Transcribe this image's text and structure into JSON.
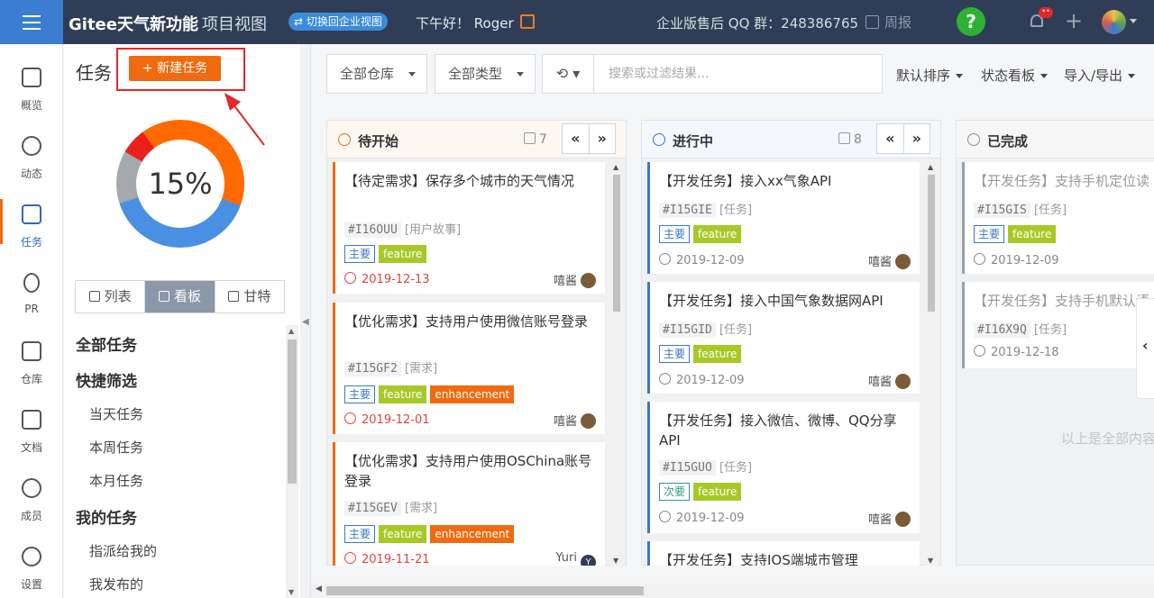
{
  "topbar": {
    "brand": "Gitee天气新功能",
    "brand_sub": "项目视图",
    "switch_label": "⇄ 切换回企业视图",
    "greeting": "下午好！ Roger",
    "qq_group": "企业版售后 QQ 群：248386765",
    "weekly": "周报",
    "help": "?",
    "notify_badge": "••"
  },
  "nav": [
    {
      "label": "概览",
      "icon": "overview-icon"
    },
    {
      "label": "动态",
      "icon": "activity-icon"
    },
    {
      "label": "任务",
      "icon": "task-icon",
      "active": true
    },
    {
      "label": "PR",
      "icon": "pull-request-icon"
    },
    {
      "label": "仓库",
      "icon": "repository-icon"
    },
    {
      "label": "文档",
      "icon": "document-icon"
    },
    {
      "label": "成员",
      "icon": "members-icon"
    },
    {
      "label": "设置",
      "icon": "settings-icon"
    }
  ],
  "panel": {
    "title": "任务",
    "new_task": "+ 新建任务",
    "progress": "15%",
    "view_tabs": [
      "列表",
      "看板",
      "甘特"
    ],
    "filters": {
      "all": "全部任务",
      "quick": "快捷筛选",
      "today": "当天任务",
      "week": "本周任务",
      "month": "本月任务",
      "mine": "我的任务",
      "assigned": "指派给我的",
      "published": "我发布的"
    }
  },
  "toolbar": {
    "repo": "全部仓库",
    "type": "全部类型",
    "search_placeholder": "搜索或过滤结果...",
    "sort": "默认排序",
    "board": "状态看板",
    "import_export": "导入/导出"
  },
  "columns": [
    {
      "title": "待开始",
      "count": "7",
      "color": "#f06a0f",
      "cards": [
        {
          "title": "【待定需求】保存多个城市的天气情况",
          "id": "#I16OUU",
          "kind": "[用户故事]",
          "tags": [
            "主要",
            "feature"
          ],
          "date": "2019-12-13",
          "assignee": "嘻酱"
        },
        {
          "title": "【优化需求】支持用户使用微信账号登录",
          "id": "#I15GF2",
          "kind": "[需求]",
          "tags": [
            "主要",
            "feature",
            "enhancement"
          ],
          "date": "2019-12-01",
          "assignee": "嘻酱"
        },
        {
          "title": "【优化需求】支持用户使用OSChina账号登录",
          "id": "#I15GEV",
          "kind": "[需求]",
          "tags": [
            "主要",
            "feature",
            "enhancement"
          ],
          "date": "2019-11-21",
          "assignee": "Yuri"
        }
      ]
    },
    {
      "title": "进行中",
      "count": "8",
      "color": "#3a78c3",
      "cards": [
        {
          "title": "【开发任务】接入xx气象API",
          "id": "#I15GIE",
          "kind": "[任务]",
          "tags": [
            "主要",
            "feature"
          ],
          "date": "2019-12-09",
          "assignee": "嘻酱"
        },
        {
          "title": "【开发任务】接入中国气象数据网API",
          "id": "#I15GID",
          "kind": "[任务]",
          "tags": [
            "主要",
            "feature"
          ],
          "date": "2019-12-09",
          "assignee": "嘻酱"
        },
        {
          "title": "【开发任务】接入微信、微博、QQ分享API",
          "id": "#I15GUO",
          "kind": "[任务]",
          "tags": [
            "次要",
            "feature"
          ],
          "date": "2019-12-09",
          "assignee": "嘻酱"
        },
        {
          "title": "【开发任务】支持IOS端城市管理"
        }
      ]
    },
    {
      "title": "已完成",
      "color": "#8a8f98",
      "cards": [
        {
          "title": "【开发任务】支持手机定位读",
          "id": "#I15GIS",
          "kind": "[任务]",
          "tags": [
            "主要",
            "feature"
          ],
          "date": "2019-12-09"
        },
        {
          "title": "【开发任务】支持手机默认语",
          "id": "#I16X9Q",
          "kind": "[任务]",
          "date": "2019-12-18"
        }
      ],
      "end_text": "以上是全部内容"
    }
  ]
}
